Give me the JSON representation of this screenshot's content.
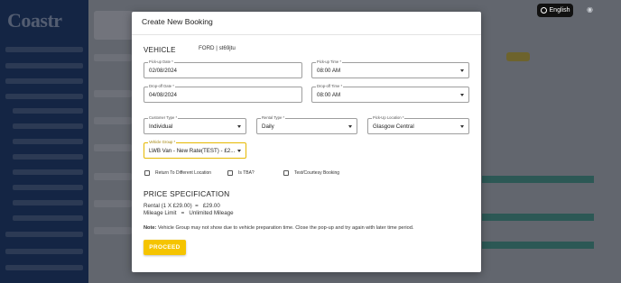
{
  "app": {
    "logo": "Coastr",
    "language": "English"
  },
  "modal": {
    "title": "Create New Booking",
    "vehicle_section": "VEHICLE",
    "vehicle_name": "FORD | st69jtu",
    "fields": {
      "pickup_date": {
        "label": "Pick-up Date *",
        "value": "02/08/2024"
      },
      "pickup_time": {
        "label": "Pick-up Time *",
        "value": "08:00 AM"
      },
      "dropoff_date": {
        "label": "Drop-off Date *",
        "value": "04/08/2024"
      },
      "dropoff_time": {
        "label": "Drop-off Time *",
        "value": "08:00 AM"
      },
      "customer_type": {
        "label": "Customer Type *",
        "value": "Individual"
      },
      "rental_type": {
        "label": "Rental Type *",
        "value": "Daily"
      },
      "pickup_location": {
        "label": "Pick-Up Location *",
        "value": "Glasgow Central"
      },
      "vehicle_group": {
        "label": "Vehicle Group *",
        "value": "LWB Van - New Rate(TEST) - £2..."
      }
    },
    "checkboxes": {
      "return_different": "Return To Different Location",
      "is_tba": "Is TBA?",
      "test_courtesy": "Test/Courtesy Booking"
    },
    "price": {
      "title": "PRICE SPECIFICATION",
      "rental_line": "Rental (1 X £29.00)  =   £29.00",
      "mileage_line": "Mileage Limit   =   Unlimited Mileage"
    },
    "note_label": "Note:",
    "note_text": " Vehicle Group may not show due to vehicle preparation time. Close the pop-up and try again with later time period.",
    "proceed_label": "PROCEED"
  },
  "colors": {
    "accent": "#f5c400",
    "sidebar": "#0b2a5b",
    "focus": "#e6b800"
  }
}
